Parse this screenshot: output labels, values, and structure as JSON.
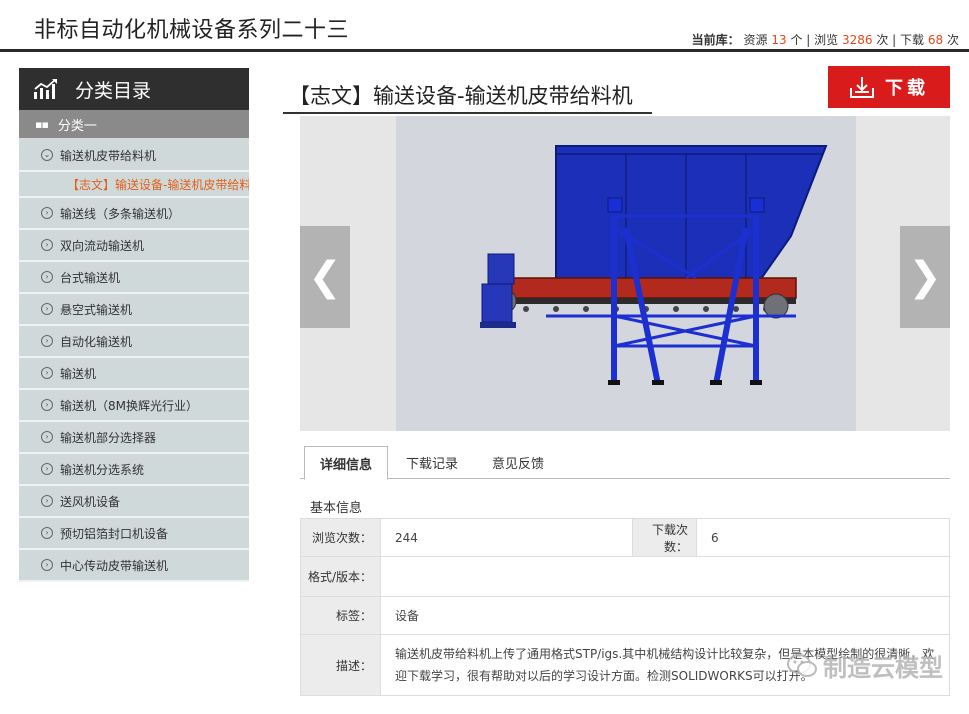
{
  "header": {
    "site_title": "非标自动化机械设备系列二十三",
    "stats": {
      "prefix": "当前库：",
      "resources_label": "资源",
      "resources_count": "13",
      "resources_unit": "个 | 浏览",
      "views_count": "3286",
      "views_unit": "次 | 下载",
      "downloads_count": "68",
      "downloads_unit": "次"
    }
  },
  "sidebar": {
    "heading": "分类目录",
    "category": "分类一",
    "items": [
      {
        "label": "输送机皮带给料机",
        "icon": "chevron-down-circle-icon"
      },
      {
        "label": "【志文】输送设备-输送机皮带给料",
        "sub": true
      },
      {
        "label": "输送线（多条输送机）",
        "icon": "chevron-right-circle-icon"
      },
      {
        "label": "双向流动输送机",
        "icon": "chevron-right-circle-icon"
      },
      {
        "label": "台式输送机",
        "icon": "chevron-right-circle-icon"
      },
      {
        "label": "悬空式输送机",
        "icon": "chevron-right-circle-icon"
      },
      {
        "label": "自动化输送机",
        "icon": "chevron-right-circle-icon"
      },
      {
        "label": "输送机",
        "icon": "chevron-right-circle-icon"
      },
      {
        "label": "输送机（8M换辉光行业）",
        "icon": "chevron-right-circle-icon"
      },
      {
        "label": "输送机部分选择器",
        "icon": "chevron-right-circle-icon"
      },
      {
        "label": "输送机分选系统",
        "icon": "chevron-right-circle-icon"
      },
      {
        "label": "送风机设备",
        "icon": "chevron-right-circle-icon"
      },
      {
        "label": "预切铝箔封口机设备",
        "icon": "chevron-right-circle-icon"
      },
      {
        "label": "中心传动皮带输送机",
        "icon": "chevron-right-circle-icon"
      }
    ]
  },
  "main": {
    "title": "【志文】输送设备-输送机皮带给料机",
    "download_label": "下载",
    "prev_arrow": "❮",
    "next_arrow": "❯",
    "tabs": [
      {
        "label": "详细信息",
        "active": true
      },
      {
        "label": "下载记录",
        "active": false
      },
      {
        "label": "意见反馈",
        "active": false
      }
    ],
    "basic_info_label": "基本信息",
    "info": {
      "views_key": "浏览次数：",
      "views_value": "244",
      "downloads_key": "下载次数：",
      "downloads_value": "6",
      "format_key": "格式/版本：",
      "format_value": "",
      "tags_key": "标签：",
      "tags_value": "设备",
      "desc_key": "描述：",
      "desc_value": "输送机皮带给料机上传了通用格式STP/igs.其中机械结构设计比较复杂，但是本模型绘制的很清晰，欢迎下载学习，很有帮助对以后的学习设计方面。检测SOLIDWORKS可以打开。"
    }
  },
  "watermark": "制造云模型",
  "colors": {
    "accent_red": "#d91b1b",
    "highlight_orange": "#e0601b",
    "hopper_blue": "#1c2fb8",
    "belt_red": "#b22a1e"
  }
}
